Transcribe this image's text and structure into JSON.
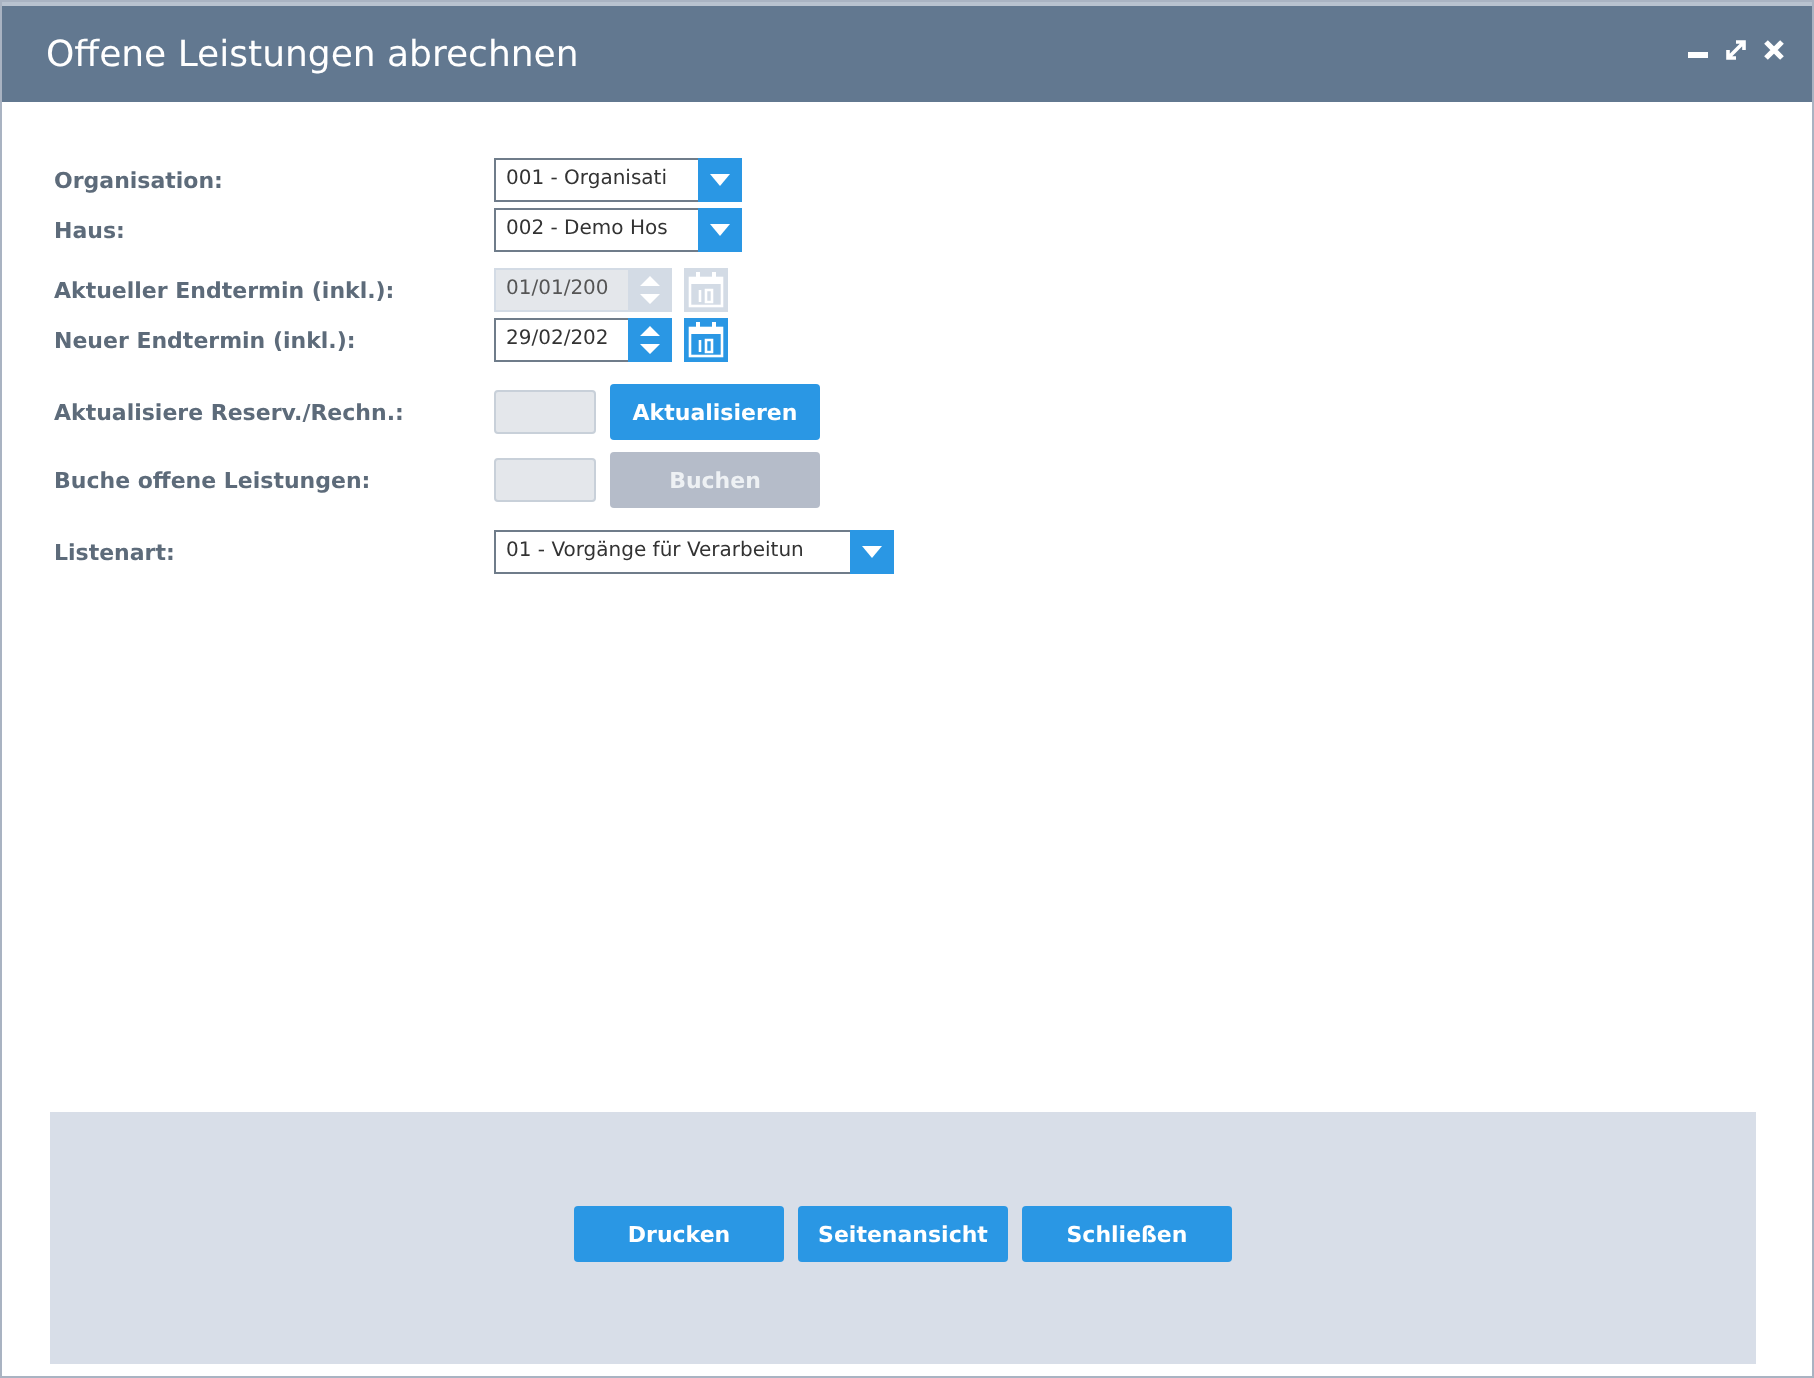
{
  "window": {
    "title": "Offene Leistungen abrechnen"
  },
  "fields": [
    {
      "kind": "select",
      "label": "Organisation:",
      "value": "001 - Organisati"
    },
    {
      "kind": "select",
      "label": "Haus:",
      "value": "002 - Demo Hos"
    },
    {
      "kind": "date",
      "label": "Aktueller Endtermin (inkl.):",
      "value": "01/01/200",
      "disabled": true
    },
    {
      "kind": "date",
      "label": "Neuer Endtermin (inkl.):",
      "value": "29/02/202",
      "disabled": false
    },
    {
      "kind": "action",
      "label": "Aktualisiere Reserv./Rechn.:",
      "button": "Aktualisieren",
      "disabled": false
    },
    {
      "kind": "action",
      "label": "Buche offene Leistungen:",
      "button": "Buchen",
      "disabled": true
    },
    {
      "kind": "wideselect",
      "label": "Listenart:",
      "value": "01 - Vorgänge für Verarbeitun"
    }
  ],
  "buttons": [
    "Drucken",
    "Seitenansicht",
    "Schließen"
  ]
}
